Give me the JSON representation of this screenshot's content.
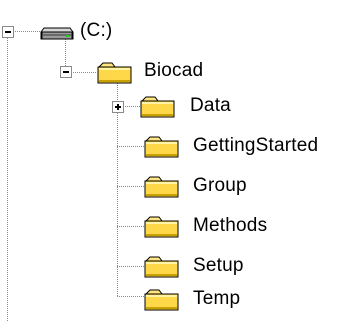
{
  "tree": {
    "drive": {
      "label": "(C:)",
      "icon": "drive-icon",
      "expanded": true
    },
    "biocad": {
      "label": "Biocad",
      "icon": "folder-icon",
      "expanded": true
    },
    "children": [
      {
        "label": "Data",
        "icon": "folder-icon",
        "has_children": true,
        "expanded": false
      },
      {
        "label": "GettingStarted",
        "icon": "folder-icon",
        "has_children": false
      },
      {
        "label": "Group",
        "icon": "folder-icon",
        "has_children": false
      },
      {
        "label": "Methods",
        "icon": "folder-icon",
        "has_children": false
      },
      {
        "label": "Setup",
        "icon": "folder-icon",
        "has_children": false
      },
      {
        "label": "Temp",
        "icon": "folder-icon",
        "has_children": false
      }
    ]
  },
  "colors": {
    "folder_fill": "#ffd84a",
    "folder_shade": "#c8a000",
    "tree_line": "#8a8a8a",
    "drive_body": "#a8a8a8"
  }
}
